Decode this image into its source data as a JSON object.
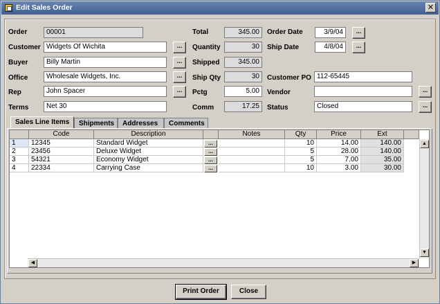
{
  "window": {
    "title": "Edit Sales Order"
  },
  "fields": {
    "order": {
      "label": "Order",
      "value": "00001"
    },
    "customer": {
      "label": "Customer",
      "value": "Widgets Of Wichita"
    },
    "buyer": {
      "label": "Buyer",
      "value": "Billy Martin"
    },
    "office": {
      "label": "Office",
      "value": "Wholesale Widgets, Inc."
    },
    "rep": {
      "label": "Rep",
      "value": "John Spacer"
    },
    "terms": {
      "label": "Terms",
      "value": "Net 30"
    },
    "total": {
      "label": "Total",
      "value": "345.00"
    },
    "quantity": {
      "label": "Quantity",
      "value": "30"
    },
    "shipped": {
      "label": "Shipped",
      "value": "345.00"
    },
    "ship_qty": {
      "label": "Ship Qty",
      "value": "30"
    },
    "pctg": {
      "label": "Pctg",
      "value": "5.00"
    },
    "comm": {
      "label": "Comm",
      "value": "17.25"
    },
    "order_date": {
      "label": "Order Date",
      "value": "3/9/04"
    },
    "ship_date": {
      "label": "Ship Date",
      "value": "4/8/04"
    },
    "customer_po": {
      "label": "Customer PO",
      "value": "112-65445"
    },
    "vendor": {
      "label": "Vendor",
      "value": ""
    },
    "status": {
      "label": "Status",
      "value": "Closed"
    }
  },
  "ellipsis_label": "...",
  "tabs": [
    "Sales Line Items",
    "Shipments",
    "Addresses",
    "Comments"
  ],
  "grid": {
    "columns": [
      "",
      "Code",
      "Description",
      "",
      "Notes",
      "Qty",
      "Price",
      "Ext"
    ],
    "rows": [
      {
        "num": "1",
        "code": "12345",
        "desc": "Standard Widget",
        "btn": "...",
        "notes": "",
        "qty": "10",
        "price": "14.00",
        "ext": "140.00"
      },
      {
        "num": "2",
        "code": "23456",
        "desc": "Deluxe Widget",
        "btn": "...",
        "notes": "",
        "qty": "5",
        "price": "28.00",
        "ext": "140.00"
      },
      {
        "num": "3",
        "code": "54321",
        "desc": "Economy Widget",
        "btn": "...",
        "notes": "",
        "qty": "5",
        "price": "7.00",
        "ext": "35.00"
      },
      {
        "num": "4",
        "code": "22334",
        "desc": "Carrying Case",
        "btn": "...",
        "notes": "",
        "qty": "10",
        "price": "3.00",
        "ext": "30.00"
      }
    ]
  },
  "buttons": {
    "print": "Print Order",
    "close": "Close"
  },
  "icons": {
    "title": "window-icon",
    "close": "close-icon",
    "up": "arrow-up-icon",
    "down": "arrow-down-icon",
    "left": "arrow-left-icon",
    "right": "arrow-right-icon"
  }
}
